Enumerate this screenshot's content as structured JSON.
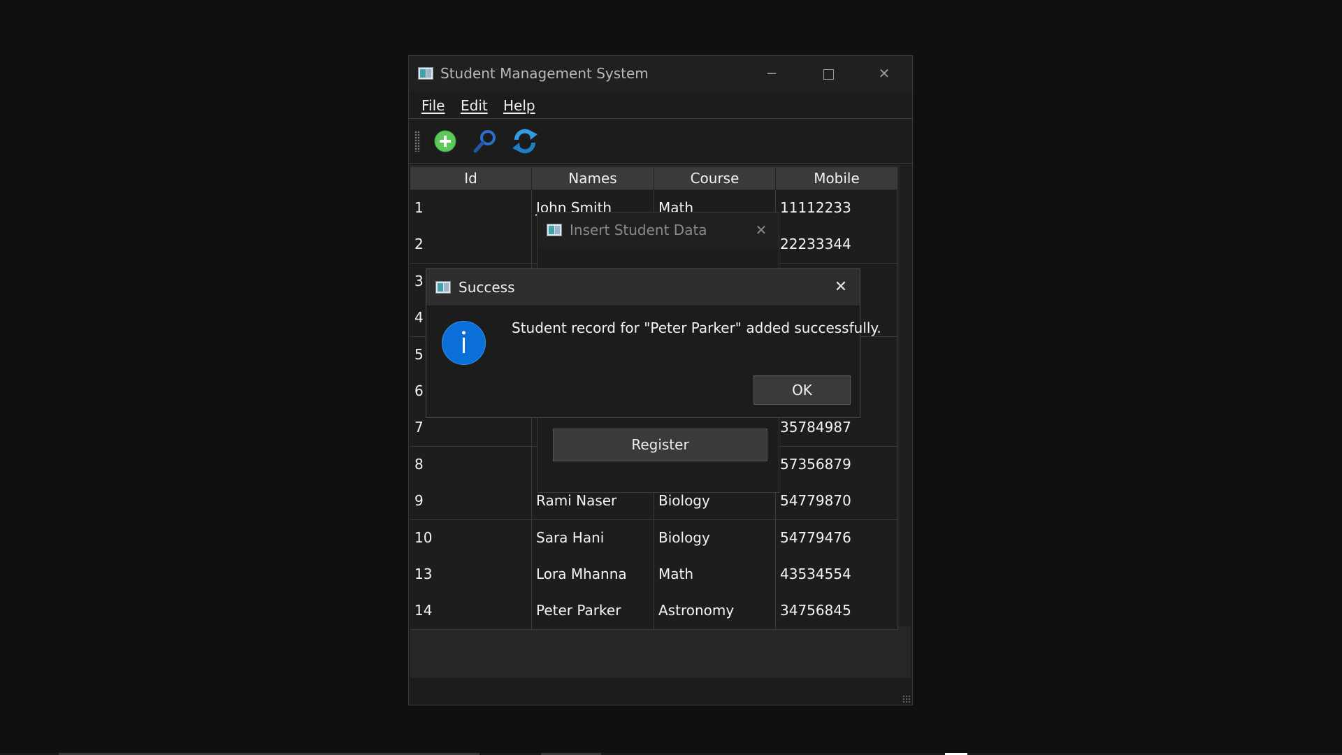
{
  "main_window": {
    "title": "Student Management System",
    "caption": {
      "minimize": "─",
      "close": "✕"
    },
    "menu": [
      "File",
      "Edit",
      "Help"
    ],
    "toolbar": [
      {
        "name": "add-icon",
        "color": "#5fc85a"
      },
      {
        "name": "search-icon",
        "color": "#2a6fd1"
      },
      {
        "name": "refresh-icon",
        "color": "#2f9be0"
      }
    ]
  },
  "table": {
    "columns": [
      "Id",
      "Names",
      "Course",
      "Mobile"
    ],
    "rows": [
      [
        "1",
        "John Smith",
        "Math",
        "11112233"
      ],
      [
        "2",
        "",
        "",
        "22233344"
      ],
      [
        "3",
        "",
        "",
        ""
      ],
      [
        "4",
        "",
        "",
        ""
      ],
      [
        "5",
        "",
        "",
        ""
      ],
      [
        "6",
        "",
        "",
        ""
      ],
      [
        "7",
        "",
        "",
        "35784987"
      ],
      [
        "8",
        "",
        "",
        "57356879"
      ],
      [
        "9",
        "Rami Naser",
        "Biology",
        "54779870"
      ],
      [
        "10",
        "Sara Hani",
        "Biology",
        "54779476"
      ],
      [
        "13",
        "Lora Mhanna",
        "Math",
        "43534554"
      ],
      [
        "14",
        "Peter Parker",
        "Astronomy",
        "34756845"
      ]
    ]
  },
  "insert_dialog": {
    "title": "Insert Student Data",
    "close": "✕",
    "register_label": "Register"
  },
  "success_dialog": {
    "title": "Success",
    "close": "✕",
    "message": "Student record for \"Peter Parker\" added successfully.",
    "ok_label": "OK",
    "icon": "info-icon",
    "accent": "#0a6fd8"
  }
}
